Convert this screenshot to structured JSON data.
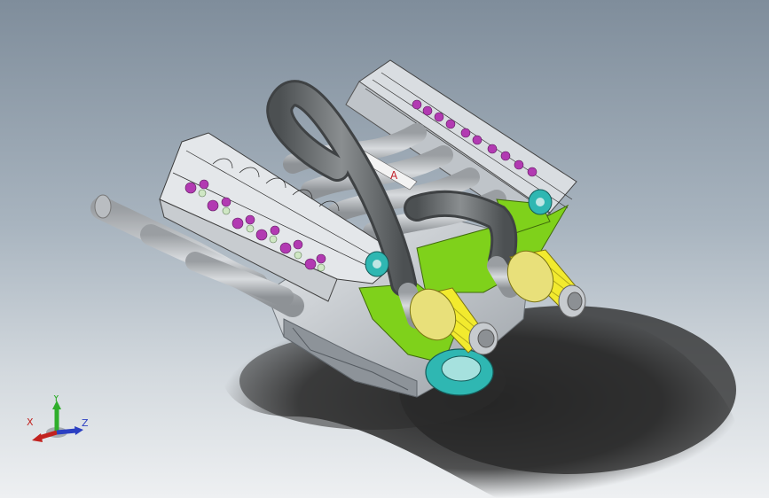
{
  "viewport": {
    "model": "v8-engine-assembly",
    "background_colors": [
      "#7f8d9b",
      "#eef0f2"
    ],
    "part_colors": {
      "intake-pipe": "#6f7374",
      "valve-springs": "#b23ab2",
      "mounting-plates": "#7fd11b",
      "air-filters": "#f2ea2e",
      "pulleys": "#2fb7b2",
      "block": "#cfd3d8",
      "headers": "#c6c9cd"
    }
  },
  "block_label": {
    "text": "A"
  },
  "triad": {
    "x_label": "X",
    "y_label": "Y",
    "z_label": "Z",
    "x_color": "#c2221f",
    "y_color": "#2fae2b",
    "z_color": "#2b3fc2"
  }
}
